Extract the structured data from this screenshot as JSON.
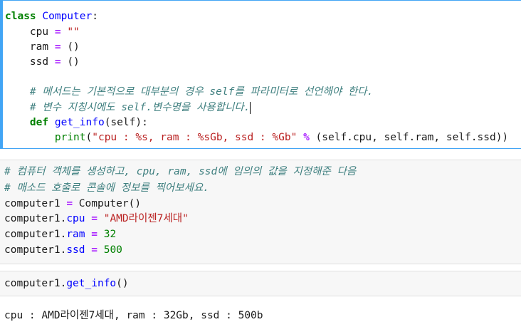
{
  "cell1": {
    "kw_class": "class",
    "class_name": "Computer",
    "colon": ":",
    "cpu_var": "cpu",
    "ram_var": "ram",
    "ssd_var": "ssd",
    "eq": "=",
    "cpu_val": "\"\"",
    "ram_val": "()",
    "ssd_val": "()",
    "comment1": "# 메서드는 기본적으로 대부분의 경우 self를 파라미터로 선언해야 한다.",
    "comment2": "# 변수 지칭시에도 self.변수명을 사용합니다.",
    "kw_def": "def",
    "func_name": "get_info",
    "func_args": "(self):",
    "print_name": "print",
    "print_open": "(",
    "print_str": "\"cpu : %s, ram : %sGb, ssd : %Gb\"",
    "print_op": "%",
    "print_args": "(self.cpu, self.ram, self.ssd))"
  },
  "cell2": {
    "comment1": "# 컴퓨터 객체를 생성하고, cpu, ram, ssd에 임의의 값을 지정해준 다음",
    "comment2": "# 매소드 호출로 콘솔에 정보를 찍어보세요.",
    "obj": "computer1",
    "eq": "=",
    "ctor": "Computer()",
    "dot": ".",
    "cpu_attr": "cpu",
    "cpu_val": "\"AMD라이젠7세대\"",
    "ram_attr": "ram",
    "ram_val": "32",
    "ssd_attr": "ssd",
    "ssd_val": "500"
  },
  "cell3": {
    "obj": "computer1",
    "dot": ".",
    "method": "get_info",
    "call": "()"
  },
  "output": {
    "text": "cpu : AMD라이젠7세대, ram : 32Gb, ssd : 500b"
  }
}
